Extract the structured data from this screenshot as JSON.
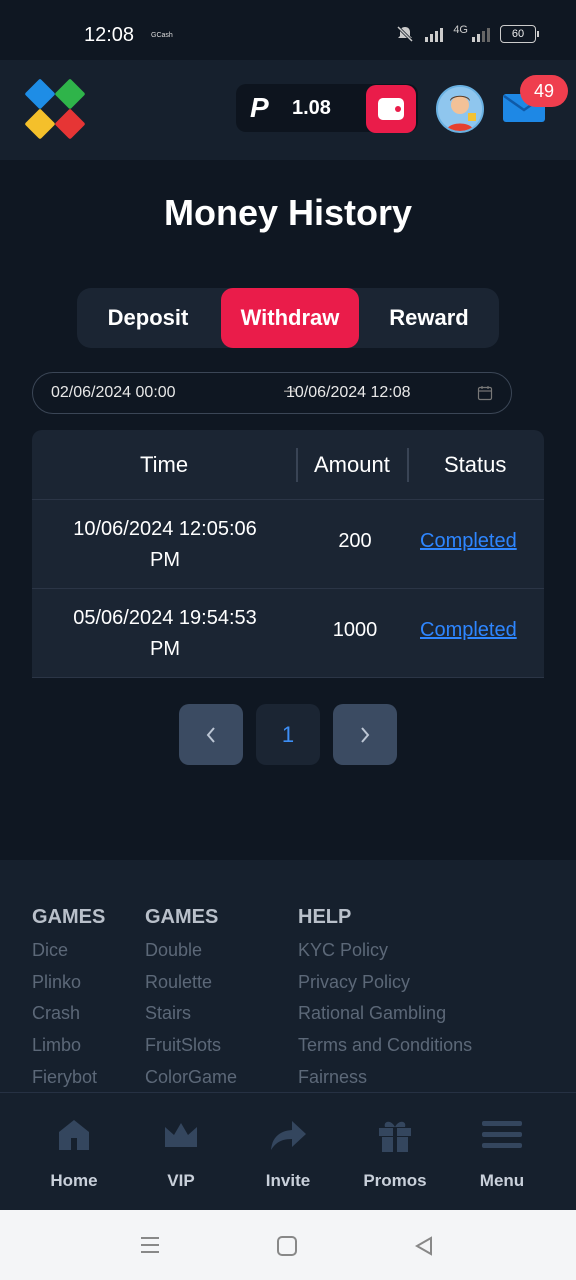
{
  "status_bar": {
    "time": "12:08",
    "app": "GCash",
    "network": "4G",
    "battery": "60"
  },
  "header": {
    "balance": "1.08",
    "currency_symbol": "P",
    "notifications": "49"
  },
  "page_title": "Money History",
  "tabs": [
    {
      "label": "Deposit",
      "active": false
    },
    {
      "label": "Withdraw",
      "active": true
    },
    {
      "label": "Reward",
      "active": false
    }
  ],
  "date_range": {
    "start": "02/06/2024 00:00",
    "end": "10/06/2024 12:08"
  },
  "table": {
    "headers": [
      "Time",
      "Amount",
      "Status"
    ],
    "rows": [
      {
        "time_line1": "10/06/2024 12:05:06",
        "time_line2": "PM",
        "amount": "200",
        "status": "Completed"
      },
      {
        "time_line1": "05/06/2024 19:54:53",
        "time_line2": "PM",
        "amount": "1000",
        "status": "Completed"
      }
    ]
  },
  "pagination": {
    "prev": "‹",
    "current": "1",
    "next": "›"
  },
  "footer": {
    "columns": [
      {
        "title": "GAMES",
        "items": [
          "Dice",
          "Plinko",
          "Crash",
          "Limbo",
          "Fierybot"
        ]
      },
      {
        "title": "GAMES",
        "items": [
          "Double",
          "Roulette",
          "Stairs",
          "FruitSlots",
          "ColorGame"
        ]
      },
      {
        "title": "HELP",
        "items": [
          "KYC Policy",
          "Privacy Policy",
          "Rational Gambling",
          "Terms and Conditions",
          "Fairness"
        ]
      }
    ]
  },
  "bottom_nav": [
    {
      "label": "Home",
      "icon": "home-icon"
    },
    {
      "label": "VIP",
      "icon": "crown-icon"
    },
    {
      "label": "Invite",
      "icon": "share-arrow-icon"
    },
    {
      "label": "Promos",
      "icon": "gift-icon"
    },
    {
      "label": "Menu",
      "icon": "menu-icon"
    }
  ],
  "colors": {
    "accent": "#ea1c4a",
    "link": "#2e86ff",
    "background": "#0f1722",
    "panel": "#1b2533"
  }
}
